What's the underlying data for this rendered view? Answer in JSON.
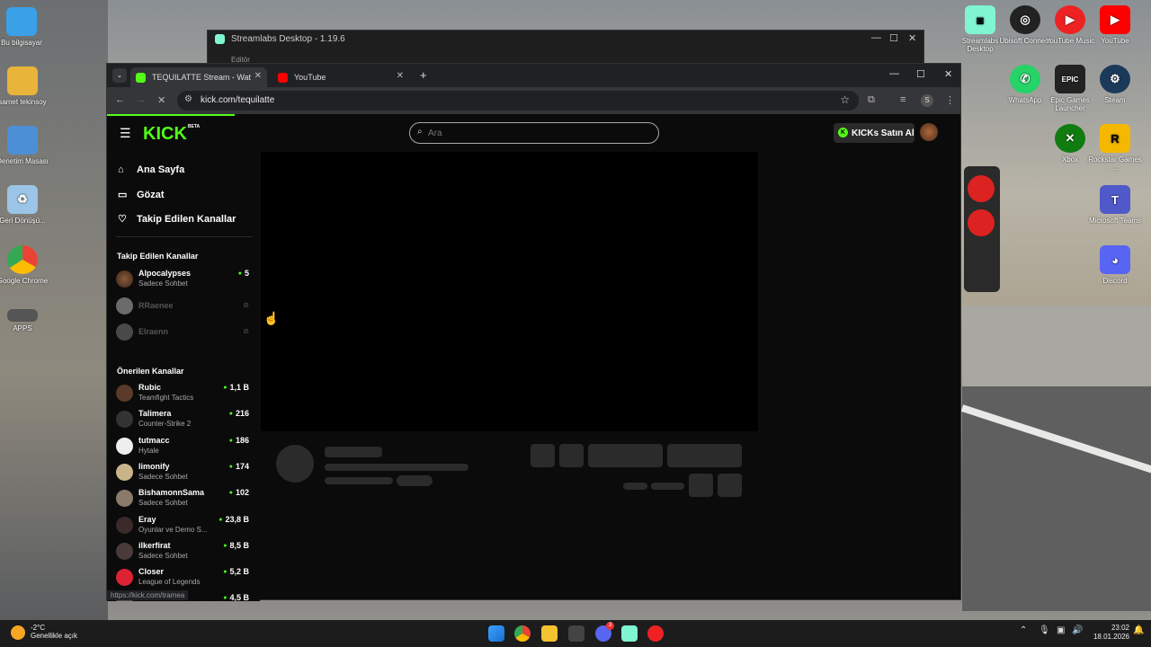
{
  "desktop": {
    "left_icons": [
      {
        "label": "Bu bilgisayar"
      },
      {
        "label": "samet tekinsoy"
      },
      {
        "label": "Denetim Masası"
      },
      {
        "label": "Geri Dönüşü..."
      },
      {
        "label": "Google Chrome"
      },
      {
        "label": "APPS"
      }
    ],
    "right_icons": [
      {
        "label": "Streamlabs Desktop"
      },
      {
        "label": "Ubisoft Connect"
      },
      {
        "label": "YouTube Music"
      },
      {
        "label": "YouTube"
      },
      {
        "label": "WhatsApp"
      },
      {
        "label": "Epic Games Launcher"
      },
      {
        "label": "Steam"
      },
      {
        "label": "Xbox"
      },
      {
        "label": "Rockstar Games ..."
      },
      {
        "label": "Microsoft Teams"
      },
      {
        "label": "Discord"
      }
    ]
  },
  "bg_window": {
    "title": "Streamlabs Desktop - 1.19.6",
    "sub": "Editör"
  },
  "browser": {
    "tabs": [
      {
        "label": "TEQUILATTE Stream - Watch Li..."
      },
      {
        "label": "YouTube"
      }
    ],
    "new_tab": "+",
    "url": "kick.com/tequilatte",
    "status_url": "https://kick.com/tramea",
    "profile_initial": "S"
  },
  "kick": {
    "logo": "KICK",
    "beta": "BETA",
    "search_placeholder": "Ara",
    "buy_button": "KICKs Satın Al",
    "nav": [
      {
        "label": "Ana Sayfa"
      },
      {
        "label": "Gözat"
      },
      {
        "label": "Takip Edilen Kanallar"
      }
    ],
    "followed_title": "Takip Edilen Kanallar",
    "followed": [
      {
        "name": "Alpocalypses",
        "sub": "Sadece Sohbet",
        "viewers": "5"
      },
      {
        "name": "RRaenee",
        "sub": "",
        "viewers": ""
      },
      {
        "name": "Elraenn",
        "sub": "",
        "viewers": ""
      }
    ],
    "suggested_title": "Önerilen Kanallar",
    "suggested": [
      {
        "name": "Rubic",
        "sub": "Teamfight Tactics",
        "viewers": "1,1 B"
      },
      {
        "name": "Talimera",
        "sub": "Counter-Strike 2",
        "viewers": "216"
      },
      {
        "name": "tutmacc",
        "sub": "Hytale",
        "viewers": "186"
      },
      {
        "name": "limonify",
        "sub": "Sadece Sohbet",
        "viewers": "174"
      },
      {
        "name": "BishamonnSama",
        "sub": "Sadece Sohbet",
        "viewers": "102"
      },
      {
        "name": "Eray",
        "sub": "Oyunlar ve Demo S...",
        "viewers": "23,8 B"
      },
      {
        "name": "ilkerfirat",
        "sub": "Sadece Sohbet",
        "viewers": "8,5 B"
      },
      {
        "name": "Closer",
        "sub": "League of Legends",
        "viewers": "5,2 B"
      },
      {
        "name": "",
        "sub": "",
        "viewers": "4,5 B"
      }
    ]
  },
  "taskbar": {
    "weather_temp": "-2°C",
    "weather_desc": "Genellikle açık",
    "time": "23:02",
    "date": "18.01.2026",
    "discord_badge": "3"
  },
  "colors": {
    "kick_green": "#53fc18",
    "page_bg": "#0b0b0b"
  }
}
